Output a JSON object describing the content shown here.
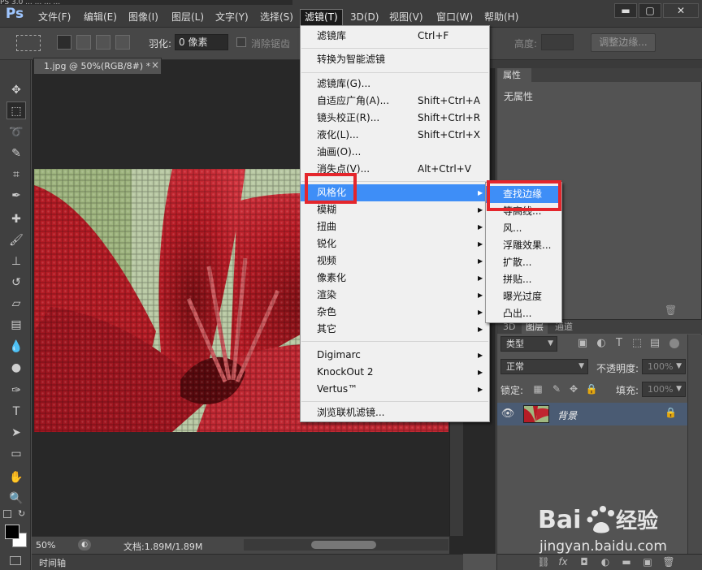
{
  "app": {
    "logo": "Ps"
  },
  "top_strip": "PS 3.0 ... ... ... ...",
  "menubar": {
    "items": [
      "文件(F)",
      "编辑(E)",
      "图像(I)",
      "图层(L)",
      "文字(Y)",
      "选择(S)",
      "滤镜(T)",
      "3D(D)",
      "视图(V)",
      "窗口(W)",
      "帮助(H)"
    ],
    "active": "滤镜(T)"
  },
  "window_controls": {
    "minimize": "▬",
    "restore": "▢",
    "close": "✕"
  },
  "options_bar": {
    "feather_label": "羽化:",
    "feather_value": "0 像素",
    "antialias_label": "消除锯齿",
    "height_label": "高度:",
    "refine_edge_button": "调整边缘..."
  },
  "document": {
    "tab_title": "1.jpg @ 50%(RGB/8#) *",
    "tab_close": "×",
    "zoom": "50%",
    "doc_info": "文档:1.89M/1.89M"
  },
  "timeline": {
    "label": "时间轴"
  },
  "filter_menu": {
    "groups": [
      [
        {
          "label": "滤镜库",
          "shortcut": "Ctrl+F"
        }
      ],
      [
        {
          "label": "转换为智能滤镜",
          "shortcut": ""
        }
      ],
      [
        {
          "label": "滤镜库(G)...",
          "shortcut": ""
        },
        {
          "label": "自适应广角(A)...",
          "shortcut": "Shift+Ctrl+A"
        },
        {
          "label": "镜头校正(R)...",
          "shortcut": "Shift+Ctrl+R"
        },
        {
          "label": "液化(L)...",
          "shortcut": "Shift+Ctrl+X"
        },
        {
          "label": "油画(O)...",
          "shortcut": ""
        },
        {
          "label": "消失点(V)...",
          "shortcut": "Alt+Ctrl+V"
        }
      ],
      [
        {
          "label": "风格化",
          "submenu": true,
          "highlighted": true
        },
        {
          "label": "模糊",
          "submenu": true
        },
        {
          "label": "扭曲",
          "submenu": true
        },
        {
          "label": "锐化",
          "submenu": true
        },
        {
          "label": "视频",
          "submenu": true
        },
        {
          "label": "像素化",
          "submenu": true
        },
        {
          "label": "渲染",
          "submenu": true
        },
        {
          "label": "杂色",
          "submenu": true
        },
        {
          "label": "其它",
          "submenu": true
        }
      ],
      [
        {
          "label": "Digimarc",
          "submenu": true
        },
        {
          "label": "KnockOut 2",
          "submenu": true
        },
        {
          "label": "Vertus™",
          "submenu": true
        }
      ],
      [
        {
          "label": "浏览联机滤镜...",
          "shortcut": ""
        }
      ]
    ]
  },
  "stylize_submenu": {
    "items": [
      "查找边缘",
      "等高线...",
      "风...",
      "浮雕效果...",
      "扩散...",
      "拼贴...",
      "曝光过度",
      "凸出..."
    ],
    "highlighted": "查找边缘"
  },
  "properties_panel": {
    "tab": "属性",
    "content": "无属性"
  },
  "layers_panel": {
    "tabs": [
      "3D",
      "图层",
      "通道"
    ],
    "active_tab": "图层",
    "filter_kind": "类型",
    "blend_mode": "正常",
    "opacity_label": "不透明度:",
    "opacity_value": "100%",
    "lock_label": "锁定:",
    "fill_label": "填充:",
    "fill_value": "100%",
    "layers": [
      {
        "name": "背景",
        "visible": true,
        "locked": true
      }
    ]
  },
  "colors": {
    "highlight": "#3e8ef7",
    "annotation_red": "#e4262c",
    "menu_bg": "#f0f0f0",
    "ui_dark": "#535353"
  },
  "icons": {
    "tools": [
      "move-icon",
      "marquee-icon",
      "lasso-icon",
      "quick-select-icon",
      "crop-icon",
      "eyedropper-icon",
      "healing-icon",
      "brush-icon",
      "stamp-icon",
      "history-brush-icon",
      "eraser-icon",
      "gradient-icon",
      "blur-icon",
      "dodge-icon",
      "pen-icon",
      "type-icon",
      "path-select-icon",
      "shape-icon",
      "hand-icon",
      "zoom-icon"
    ]
  }
}
